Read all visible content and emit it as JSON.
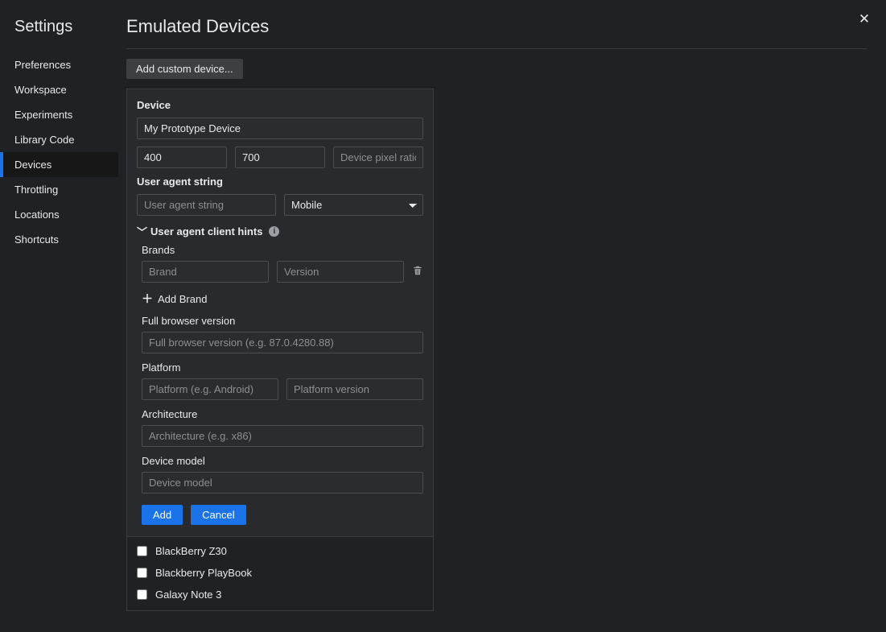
{
  "sidebar": {
    "title": "Settings",
    "items": [
      {
        "label": "Preferences",
        "selected": false
      },
      {
        "label": "Workspace",
        "selected": false
      },
      {
        "label": "Experiments",
        "selected": false
      },
      {
        "label": "Library Code",
        "selected": false
      },
      {
        "label": "Devices",
        "selected": true
      },
      {
        "label": "Throttling",
        "selected": false
      },
      {
        "label": "Locations",
        "selected": false
      },
      {
        "label": "Shortcuts",
        "selected": false
      }
    ]
  },
  "page": {
    "title": "Emulated Devices",
    "add_custom_label": "Add custom device..."
  },
  "form": {
    "device_section_label": "Device",
    "device_name": "My Prototype Device",
    "width": "400",
    "height": "700",
    "dpr_placeholder": "Device pixel ratio",
    "ua_section_label": "User agent string",
    "ua_placeholder": "User agent string",
    "ua_type_selected": "Mobile",
    "client_hints_label": "User agent client hints",
    "brands_label": "Brands",
    "brand_placeholder": "Brand",
    "version_placeholder": "Version",
    "add_brand_label": "Add Brand",
    "full_browser_label": "Full browser version",
    "full_browser_placeholder": "Full browser version (e.g. 87.0.4280.88)",
    "platform_label": "Platform",
    "platform_placeholder": "Platform (e.g. Android)",
    "platform_version_placeholder": "Platform version",
    "arch_label": "Architecture",
    "arch_placeholder": "Architecture (e.g. x86)",
    "device_model_label": "Device model",
    "device_model_placeholder": "Device model",
    "add_label": "Add",
    "cancel_label": "Cancel"
  },
  "devices": [
    {
      "label": "BlackBerry Z30",
      "checked": false
    },
    {
      "label": "Blackberry PlayBook",
      "checked": false
    },
    {
      "label": "Galaxy Note 3",
      "checked": false
    }
  ]
}
